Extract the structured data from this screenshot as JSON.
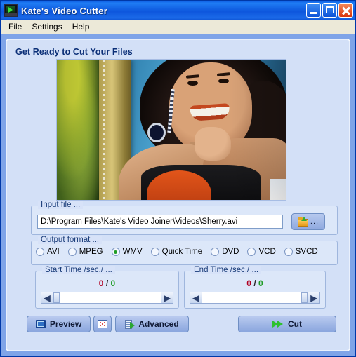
{
  "window": {
    "title": "Kate's Video Cutter",
    "app_icon": "video-play-icon",
    "buttons": {
      "minimize": "Minimize",
      "maximize": "Maximize",
      "close": "Close"
    }
  },
  "menubar": {
    "items": [
      {
        "label": "File"
      },
      {
        "label": "Settings"
      },
      {
        "label": "Help"
      }
    ]
  },
  "main": {
    "page_title": "Get Ready to Cut Your Files",
    "preview": {
      "alt": "video-preview-frame"
    },
    "input_file": {
      "legend": "Input file ...",
      "value": "D:\\Program Files\\Kate's Video Joiner\\Videos\\Sherry.avi",
      "placeholder": "",
      "browse_icon": "open-folder-icon",
      "browse_dots": "..."
    },
    "output_format": {
      "legend": "Output format ...",
      "selected": "WMV",
      "options": [
        {
          "label": "AVI",
          "selected": false
        },
        {
          "label": "MPEG",
          "selected": false
        },
        {
          "label": "WMV",
          "selected": true
        },
        {
          "label": "Quick Time",
          "selected": false
        },
        {
          "label": "DVD",
          "selected": false
        },
        {
          "label": "VCD",
          "selected": false
        },
        {
          "label": "SVCD",
          "selected": false
        }
      ]
    },
    "start_time": {
      "legend": "Start Time /sec./ ...",
      "current": "0",
      "separator": "/",
      "total": "0",
      "slider_position": "left",
      "left_arrow": "◀",
      "right_arrow": "▶"
    },
    "end_time": {
      "legend": "End Time /sec./ ...",
      "current": "0",
      "separator": "/",
      "total": "0",
      "slider_position": "right",
      "left_arrow": "◀",
      "right_arrow": "▶"
    },
    "actions": {
      "preview": {
        "label": "Preview",
        "icon": "monitor-icon"
      },
      "snapshot": {
        "label": "",
        "icon": "dice-icon"
      },
      "advanced": {
        "label": "Advanced",
        "icon": "document-arrow-icon"
      },
      "cut": {
        "label": "Cut",
        "icon": "fast-forward-icon"
      }
    }
  },
  "colors": {
    "titlebar": "#1064e0",
    "menubar": "#ece9d8",
    "body": "#7fa4e8",
    "panel": "#d3e0f7",
    "group": "#dce7f9",
    "heading": "#0b2f77",
    "accent_green": "#1f9c25",
    "accent_red": "#b00022",
    "close_button": "#d8350d"
  }
}
